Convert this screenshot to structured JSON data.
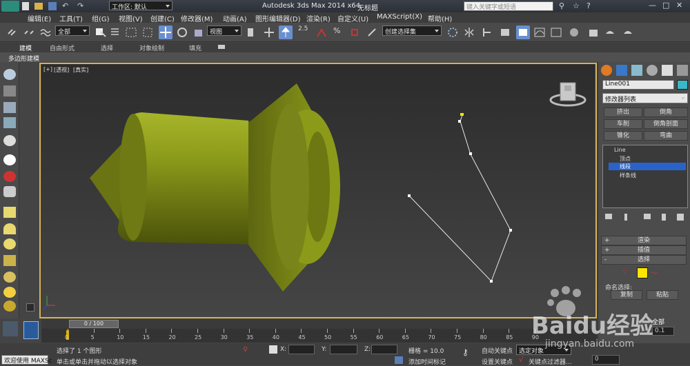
{
  "title_bar": {
    "workspace_label": "工作区: 默认",
    "app_title": "Autodesk 3ds Max  2014 x64",
    "file_title": "无标题",
    "search_placeholder": "键入关键字或短语"
  },
  "menu": {
    "items": [
      "编辑(E)",
      "工具(T)",
      "组(G)",
      "视图(V)",
      "创建(C)",
      "修改器(M)",
      "动画(A)",
      "图形编辑器(D)",
      "渲染(R)",
      "自定义(U)",
      "MAXScript(X)",
      "帮助(H)"
    ]
  },
  "toolbar": {
    "selection_filter": "全部",
    "reference_coord": "视图",
    "snap_value": "2.5",
    "named_selection": "创建选择集"
  },
  "ribbon": {
    "tabs": [
      "建模",
      "自由形式",
      "选择",
      "对象绘制",
      "填充"
    ],
    "subtitle": "多边形建模"
  },
  "viewport": {
    "label_plus": "[+]",
    "label_view": "[透视]",
    "label_shade": "[真实]"
  },
  "command_panel": {
    "object_name": "Line001",
    "modifier_list": "修改器列表",
    "buttons": [
      [
        "挤出",
        "倒角"
      ],
      [
        "车削",
        "倒角剖面"
      ],
      [
        "锥化",
        "弯曲"
      ]
    ],
    "stack": {
      "root": "Line",
      "vertex": "顶点",
      "segment": "线段",
      "spline": "样条线"
    },
    "rollouts": {
      "render": "渲染",
      "interp": "插值",
      "select": "选择"
    },
    "named_selection": "命名选择:",
    "copy": "复制",
    "paste": "粘贴",
    "all_label": "全部",
    "spinner_value": "0.1"
  },
  "timeline": {
    "frame_display": "0 / 100",
    "ticks": [
      "0",
      "5",
      "10",
      "15",
      "20",
      "25",
      "30",
      "35",
      "40",
      "45",
      "50",
      "55",
      "60",
      "65",
      "70",
      "75",
      "80",
      "85",
      "90"
    ]
  },
  "status": {
    "welcome": "欢迎使用 MAXSc",
    "selected": "选择了 1 个图形",
    "prompt": "单击或单击并拖动以选择对象",
    "x_label": "X:",
    "y_label": "Y:",
    "z_label": "Z:",
    "grid": "栅格 = 10.0",
    "auto_key": "自动关键点",
    "set_key": "设置关键点",
    "selected_obj": "选定对象",
    "key_filter": "关键点过滤器...",
    "add_tag": "添加时间标记",
    "frame_value": "0"
  },
  "watermark": {
    "brand": "Baidu经验",
    "url": "jingyan.baidu.com"
  },
  "colors": {
    "viewport_border": "#d6b25a",
    "object_green": "#8c9a1a",
    "selection_blue": "#2a63c8"
  }
}
